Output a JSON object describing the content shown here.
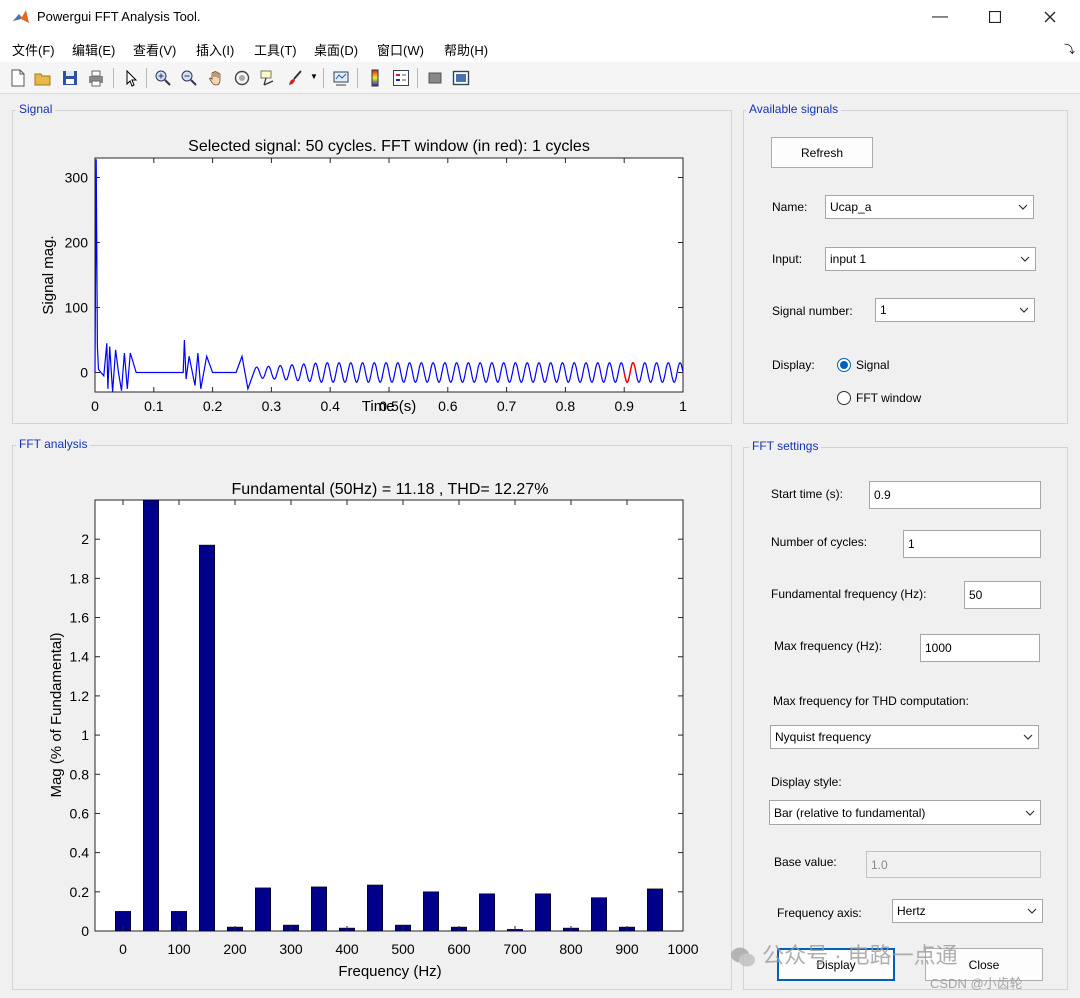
{
  "window": {
    "title": "Powergui FFT Analysis Tool."
  },
  "menu": [
    "文件(F)",
    "编辑(E)",
    "查看(V)",
    "插入(I)",
    "工具(T)",
    "桌面(D)",
    "窗口(W)",
    "帮助(H)"
  ],
  "toolbar": [
    "new-figure-icon",
    "open-file-icon",
    "save-icon",
    "print-icon",
    "pointer-icon",
    "zoom-in-icon",
    "zoom-out-icon",
    "pan-icon",
    "rotate-3d-icon",
    "data-cursor-icon",
    "brush-icon",
    "link-plot-icon",
    "colorbar-icon",
    "legend-icon",
    "hide-plot-tools-icon",
    "show-plot-tools-icon"
  ],
  "signal_panel": {
    "title": "Signal",
    "plot_title": "Selected signal: 50 cycles. FFT window (in red): 1 cycles",
    "xlabel": "Time (s)",
    "ylabel": "Signal mag."
  },
  "fft_panel": {
    "title": "FFT analysis",
    "plot_title": "Fundamental (50Hz) = 11.18 , THD= 12.27%",
    "xlabel": "Frequency (Hz)",
    "ylabel": "Mag (% of Fundamental)"
  },
  "available_signals": {
    "title": "Available signals",
    "refresh_label": "Refresh",
    "name_label": "Name:",
    "name_value": "Ucap_a",
    "input_label": "Input:",
    "input_value": "input 1",
    "signal_number_label": "Signal number:",
    "signal_number_value": "1",
    "display_label": "Display:",
    "display_signal": "Signal",
    "display_fft": "FFT window",
    "display_selected": "Signal"
  },
  "fft_settings": {
    "title": "FFT settings",
    "start_time_label": "Start time (s):",
    "start_time_value": "0.9",
    "cycles_label": "Number of cycles:",
    "cycles_value": "1",
    "fund_freq_label": "Fundamental frequency (Hz):",
    "fund_freq_value": "50",
    "max_freq_label": "Max frequency (Hz):",
    "max_freq_value": "1000",
    "thd_label": "Max frequency for THD computation:",
    "thd_value": "Nyquist frequency",
    "display_style_label": "Display style:",
    "display_style_value": "Bar (relative to fundamental)",
    "base_value_label": "Base value:",
    "base_value_value": "1.0",
    "freq_axis_label": "Frequency axis:",
    "freq_axis_value": "Hertz",
    "display_button": "Display",
    "close_button": "Close"
  },
  "watermark": {
    "wechat": "公众号 · 电路一点通",
    "csdn": "CSDN @小齿轮"
  },
  "colors": {
    "trace": "#0000ff",
    "fft_window": "#ff0000",
    "bar": "#00008b",
    "panel_title": "#1433b6"
  },
  "chart_data": [
    {
      "type": "line",
      "title": "Selected signal: 50 cycles. FFT window (in red): 1 cycles",
      "xlabel": "Time (s)",
      "ylabel": "Signal mag.",
      "xlim": [
        0,
        1
      ],
      "ylim": [
        -30,
        330
      ],
      "xticks": [
        0,
        0.1,
        0.2,
        0.3,
        0.4,
        0.5,
        0.6,
        0.7,
        0.8,
        0.9,
        1
      ],
      "xtick_labels": [
        "0",
        "0.1",
        "0.2",
        "0.3",
        "0.4",
        "0.5",
        "0.6",
        "0.7",
        "0.8",
        "0.9",
        "1"
      ],
      "yticks": [
        0,
        100,
        200,
        300
      ],
      "ytick_labels": [
        "0",
        "100",
        "200",
        "300"
      ],
      "series": [
        {
          "values_description": "",
          "x": [
            0,
            0.002,
            0.004,
            0.006,
            0.01,
            0.015,
            0.02,
            0.022,
            0.025,
            0.03,
            0.035,
            0.04,
            0.045,
            0.05,
            0.055,
            0.06,
            0.07,
            0.09,
            0.12,
            0.15,
            0.152,
            0.155,
            0.16,
            0.17,
            0.175,
            0.18,
            0.19,
            0.2,
            0.21,
            0.24,
            0.25,
            0.26,
            0.27
          ],
          "y": [
            0,
            328,
            40,
            5,
            0,
            -5,
            45,
            -25,
            40,
            -30,
            35,
            0,
            -28,
            30,
            -25,
            30,
            0,
            0,
            0,
            0,
            50,
            -10,
            25,
            -20,
            30,
            -25,
            25,
            0,
            0,
            0,
            25,
            -25,
            0
          ]
        }
      ],
      "fft_window": [
        0.9,
        0.92
      ],
      "grid": false
    },
    {
      "type": "bar",
      "title": "Fundamental (50Hz) = 11.18 , THD= 12.27%",
      "xlabel": "Frequency (Hz)",
      "ylabel": "Mag (% of Fundamental)",
      "xlim": [
        -50,
        1000
      ],
      "ylim": [
        0,
        2.2
      ],
      "xticks": [
        0,
        100,
        200,
        300,
        400,
        500,
        600,
        700,
        800,
        900,
        1000
      ],
      "xtick_labels": [
        "0",
        "100",
        "200",
        "300",
        "400",
        "500",
        "600",
        "700",
        "800",
        "900",
        "1000"
      ],
      "yticks": [
        0,
        0.2,
        0.4,
        0.6,
        0.8,
        1,
        1.2,
        1.4,
        1.6,
        1.8,
        2
      ],
      "ytick_labels": [
        "0",
        "0.2",
        "0.4",
        "0.6",
        "0.8",
        "1",
        "1.2",
        "1.4",
        "1.6",
        "1.8",
        "2"
      ],
      "x": [
        0,
        50,
        100,
        150,
        200,
        250,
        300,
        350,
        400,
        450,
        500,
        550,
        600,
        650,
        700,
        750,
        800,
        850,
        900,
        950
      ],
      "values": [
        0.1,
        2.2,
        0.1,
        1.97,
        0.02,
        0.22,
        0.03,
        0.225,
        0.015,
        0.235,
        0.03,
        0.2,
        0.02,
        0.19,
        0.008,
        0.19,
        0.015,
        0.17,
        0.02,
        0.215
      ],
      "grid": false
    }
  ]
}
